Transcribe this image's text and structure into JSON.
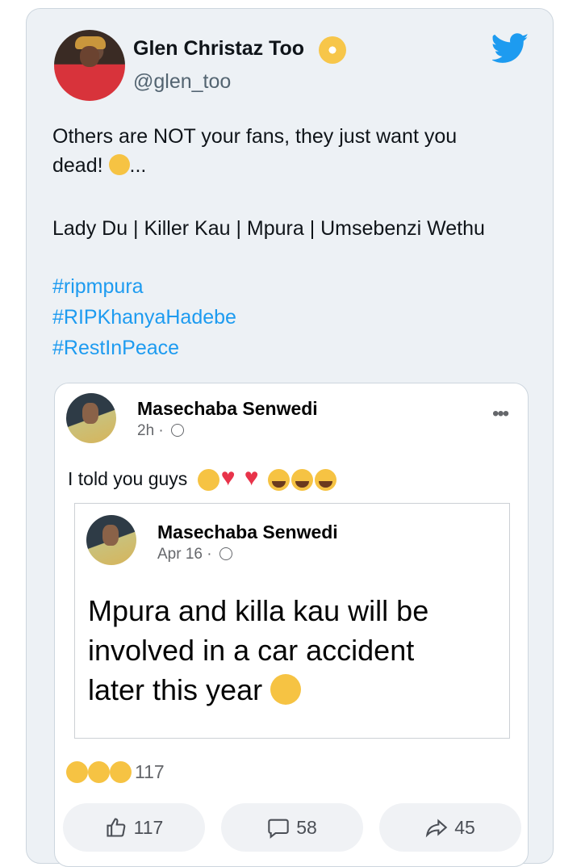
{
  "tweet": {
    "author_name": "Glen Christaz Too",
    "handle": "@glen_too",
    "text_line1": "Others are NOT your fans, they just want you",
    "text_line2_prefix": "dead!",
    "text_line2_suffix": "...",
    "text_line3": "Lady Du | Killer Kau | Mpura | Umsebenzi Wethu",
    "hashtags": [
      "#ripmpura",
      "#RIPKhanyaHadebe",
      "#RestInPeace"
    ]
  },
  "fb_post": {
    "author": "Masechaba Senwedi",
    "time": "2h",
    "text": "I told you guys",
    "shared": {
      "author": "Masechaba Senwedi",
      "date": "Apr 16",
      "line1": "Mpura and killa kau will be",
      "line2": "involved in a car accident",
      "line3": "later this year"
    },
    "reaction_count": "117",
    "actions": {
      "likes": "117",
      "comments": "58",
      "shares": "45"
    }
  },
  "colors": {
    "hashtag": "#1d9bf0",
    "twitter_blue": "#1d9bf0",
    "card_bg": "#edf1f5"
  }
}
